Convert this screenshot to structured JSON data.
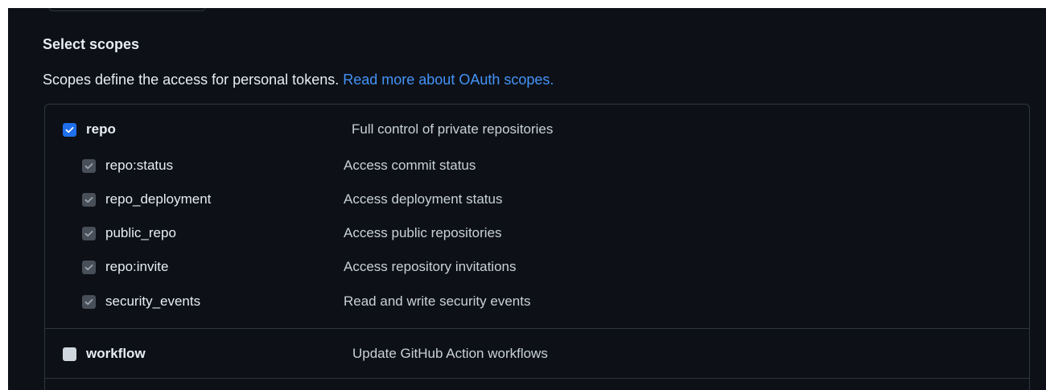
{
  "section": {
    "title": "Select scopes",
    "description": "Scopes define the access for personal tokens.",
    "link_text": "Read more about OAuth scopes."
  },
  "scopes": {
    "repo": {
      "label": "repo",
      "description": "Full control of private repositories",
      "checked": true
    },
    "children": [
      {
        "label": "repo:status",
        "description": "Access commit status",
        "checked": true,
        "disabled": true
      },
      {
        "label": "repo_deployment",
        "description": "Access deployment status",
        "checked": true,
        "disabled": true
      },
      {
        "label": "public_repo",
        "description": "Access public repositories",
        "checked": true,
        "disabled": true
      },
      {
        "label": "repo:invite",
        "description": "Access repository invitations",
        "checked": true,
        "disabled": true
      },
      {
        "label": "security_events",
        "description": "Read and write security events",
        "checked": true,
        "disabled": true
      }
    ],
    "workflow": {
      "label": "workflow",
      "description": "Update GitHub Action workflows",
      "checked": false
    }
  },
  "colors": {
    "background": "#0d1117",
    "text": "#e6edf3",
    "link": "#4493f8",
    "border": "#30363d",
    "checked_box": "#1f6feb",
    "disabled_box": "#484f58",
    "unchecked_box": "#d0d7de"
  },
  "icons": {
    "checkmark": "check-icon"
  }
}
